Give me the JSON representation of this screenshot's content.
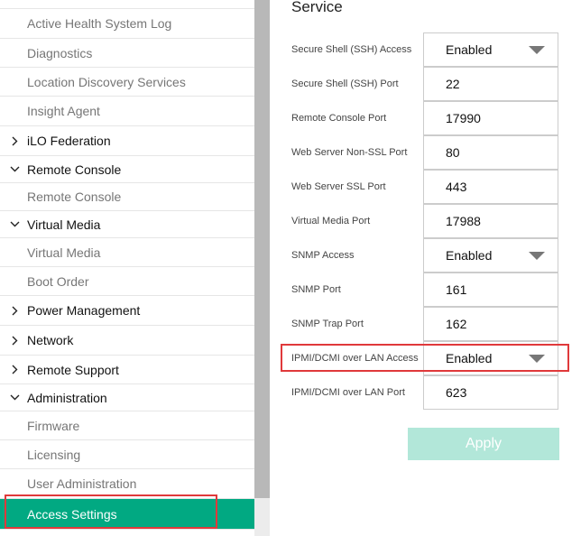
{
  "sidebar": {
    "items": [
      {
        "label": "Active Health System Log",
        "type": "sub"
      },
      {
        "label": "Diagnostics",
        "type": "sub"
      },
      {
        "label": "Location Discovery Services",
        "type": "sub"
      },
      {
        "label": "Insight Agent",
        "type": "sub"
      },
      {
        "label": "iLO Federation",
        "type": "group",
        "expanded": false
      },
      {
        "label": "Remote Console",
        "type": "group",
        "expanded": true
      },
      {
        "label": "Remote Console",
        "type": "sub"
      },
      {
        "label": "Virtual Media",
        "type": "group",
        "expanded": true
      },
      {
        "label": "Virtual Media",
        "type": "sub"
      },
      {
        "label": "Boot Order",
        "type": "sub"
      },
      {
        "label": "Power Management",
        "type": "group",
        "expanded": false
      },
      {
        "label": "Network",
        "type": "group",
        "expanded": false
      },
      {
        "label": "Remote Support",
        "type": "group",
        "expanded": false
      },
      {
        "label": "Administration",
        "type": "group",
        "expanded": true
      },
      {
        "label": "Firmware",
        "type": "sub"
      },
      {
        "label": "Licensing",
        "type": "sub"
      },
      {
        "label": "User Administration",
        "type": "sub"
      },
      {
        "label": "Access Settings",
        "type": "sub",
        "active": true
      }
    ]
  },
  "main": {
    "section_title": "Service",
    "rows": [
      {
        "label": "Secure Shell (SSH) Access",
        "value": "Enabled",
        "kind": "select"
      },
      {
        "label": "Secure Shell (SSH) Port",
        "value": "22",
        "kind": "input"
      },
      {
        "label": "Remote Console Port",
        "value": "17990",
        "kind": "input"
      },
      {
        "label": "Web Server Non-SSL Port",
        "value": "80",
        "kind": "input"
      },
      {
        "label": "Web Server SSL Port",
        "value": "443",
        "kind": "input"
      },
      {
        "label": "Virtual Media Port",
        "value": "17988",
        "kind": "input"
      },
      {
        "label": "SNMP Access",
        "value": "Enabled",
        "kind": "select"
      },
      {
        "label": "SNMP Port",
        "value": "161",
        "kind": "input"
      },
      {
        "label": "SNMP Trap Port",
        "value": "162",
        "kind": "input"
      },
      {
        "label": "IPMI/DCMI over LAN Access",
        "value": "Enabled",
        "kind": "select"
      },
      {
        "label": "IPMI/DCMI over LAN Port",
        "value": "623",
        "kind": "input"
      }
    ],
    "apply_label": "Apply"
  },
  "colors": {
    "accent": "#01a982",
    "apply_disabled": "#b2e7d9",
    "highlight": "#e0393b"
  }
}
